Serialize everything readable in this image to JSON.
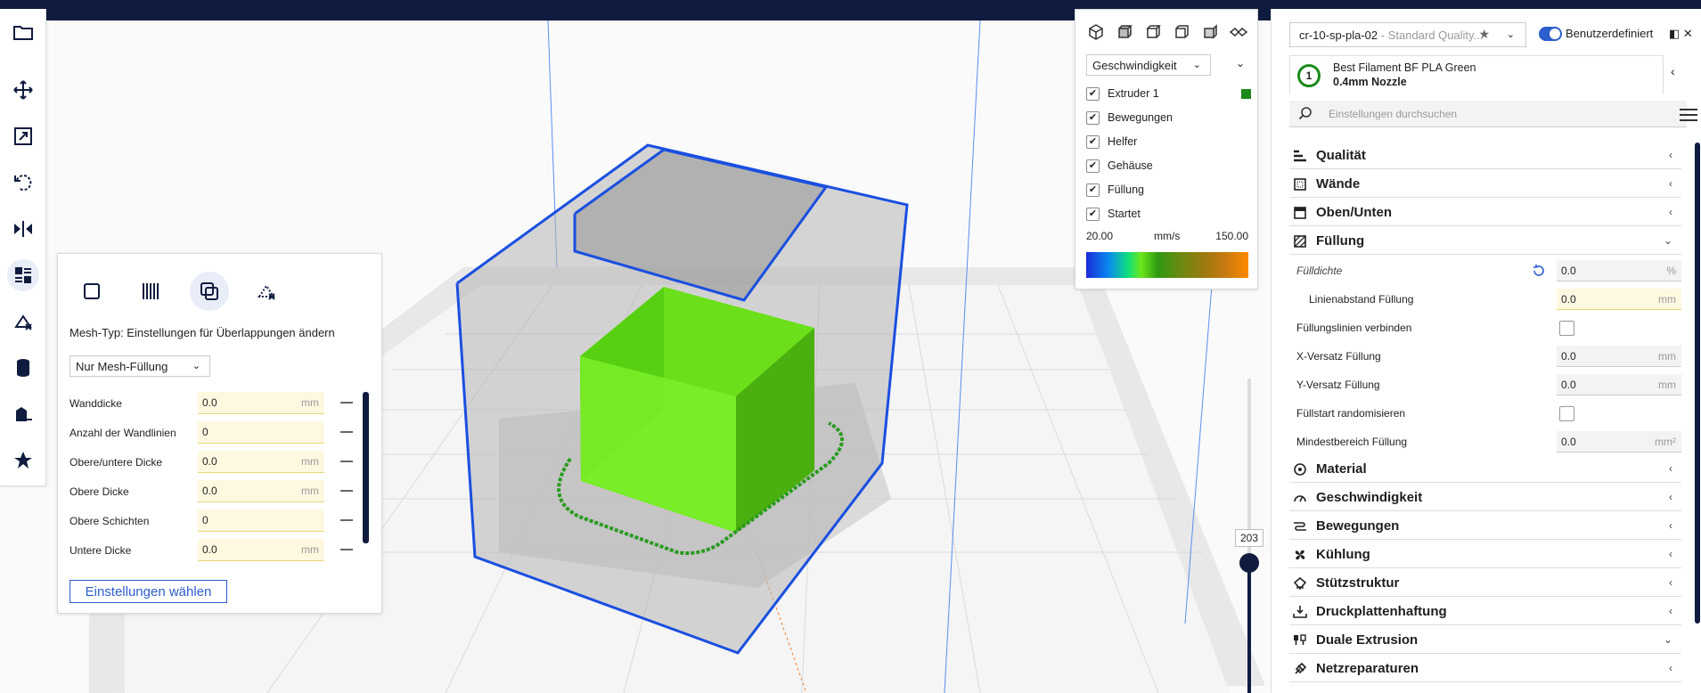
{
  "mesh_panel": {
    "label": "Mesh-Typ: Einstellungen für Überlappungen ändern",
    "dropdown": "Nur Mesh-Füllung",
    "rows": [
      {
        "label": "Wanddicke",
        "value": "0.0",
        "unit": "mm"
      },
      {
        "label": "Anzahl der Wandlinien",
        "value": "0",
        "unit": ""
      },
      {
        "label": "Obere/untere Dicke",
        "value": "0.0",
        "unit": "mm"
      },
      {
        "label": "Obere Dicke",
        "value": "0.0",
        "unit": "mm"
      },
      {
        "label": "Obere Schichten",
        "value": "0",
        "unit": ""
      },
      {
        "label": "Untere Dicke",
        "value": "0.0",
        "unit": "mm"
      }
    ],
    "button": "Einstellungen wählen"
  },
  "legend": {
    "dropdown": "Geschwindigkeit",
    "items": [
      "Extruder 1",
      "Bewegungen",
      "Helfer",
      "Gehäuse",
      "Füllung",
      "Startet"
    ],
    "min": "20.00",
    "unit": "mm/s",
    "max": "150.00",
    "extruder_color": "#1a8a1a"
  },
  "layer_slider": {
    "value": "203"
  },
  "right_panel": {
    "profile": "cr-10-sp-pla-02",
    "profile_sub": " - Standard Quality...",
    "custom_label": "Benutzerdefiniert",
    "material_number": "1",
    "material_name": "Best Filament BF PLA Green",
    "nozzle": "0.4mm Nozzle",
    "search_placeholder": "Einstellungen durchsuchen",
    "categories_top": [
      {
        "name": "Qualität",
        "icon": "quality-icon"
      },
      {
        "name": "Wände",
        "icon": "walls-icon"
      },
      {
        "name": "Oben/Unten",
        "icon": "top-bottom-icon"
      },
      {
        "name": "Füllung",
        "icon": "infill-icon"
      }
    ],
    "infill_settings": [
      {
        "label": "Fülldichte",
        "value": "0.0",
        "unit": "%",
        "type": "input",
        "italic": true,
        "reset": true
      },
      {
        "label": "Linienabstand Füllung",
        "value": "0.0",
        "unit": "mm",
        "type": "input",
        "warn": true,
        "indent": true
      },
      {
        "label": "Füllungslinien verbinden",
        "type": "checkbox"
      },
      {
        "label": "X-Versatz Füllung",
        "value": "0.0",
        "unit": "mm",
        "type": "input"
      },
      {
        "label": "Y-Versatz Füllung",
        "value": "0.0",
        "unit": "mm",
        "type": "input"
      },
      {
        "label": "Füllstart randomisieren",
        "type": "checkbox"
      },
      {
        "label": "Mindestbereich Füllung",
        "value": "0.0",
        "unit": "mm²",
        "type": "input"
      }
    ],
    "categories_bottom": [
      {
        "name": "Material",
        "icon": "material-icon"
      },
      {
        "name": "Geschwindigkeit",
        "icon": "speed-icon"
      },
      {
        "name": "Bewegungen",
        "icon": "travel-icon"
      },
      {
        "name": "Kühlung",
        "icon": "cooling-icon"
      },
      {
        "name": "Stützstruktur",
        "icon": "support-icon"
      },
      {
        "name": "Druckplattenhaftung",
        "icon": "adhesion-icon"
      },
      {
        "name": "Duale Extrusion",
        "icon": "dual-extrusion-icon"
      },
      {
        "name": "Netzreparaturen",
        "icon": "mesh-fix-icon"
      }
    ]
  }
}
